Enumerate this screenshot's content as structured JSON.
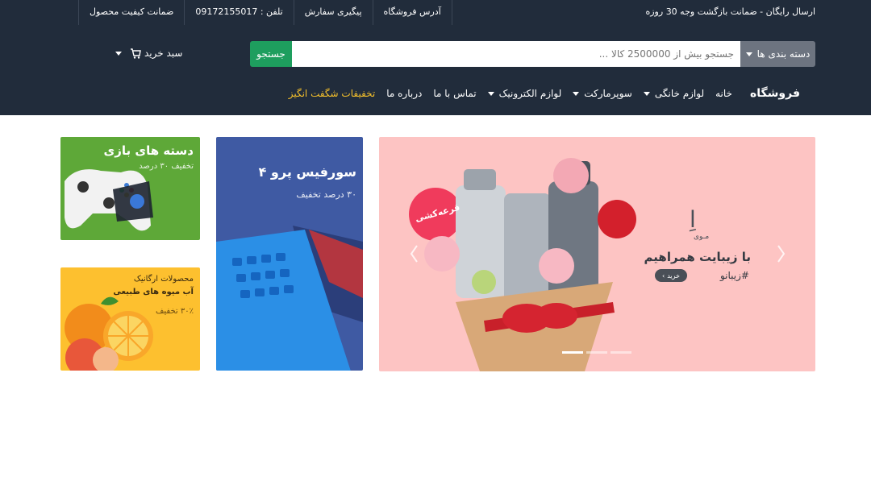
{
  "topbar": {
    "promo": "ارسال رایگان - ضمانت بازگشت وجه 30 روزه",
    "links": [
      "آدرس فروشگاه",
      "پیگیری سفارش",
      "تلفن : 09172155017",
      "ضمانت کیفیت محصول"
    ]
  },
  "search": {
    "category_label": "دسته بندی ها",
    "placeholder": "جستجو بیش از 2500000 کالا ...",
    "button_label": "جستجو"
  },
  "cart": {
    "label": "سبد خرید"
  },
  "nav": {
    "brand": "فروشگاه",
    "items": [
      {
        "label": "خانه",
        "dropdown": false
      },
      {
        "label": "لوازم خانگی",
        "dropdown": true
      },
      {
        "label": "سوپرمارکت",
        "dropdown": true
      },
      {
        "label": "لوازم الکترونیک",
        "dropdown": true
      },
      {
        "label": "تماس با ما",
        "dropdown": false
      },
      {
        "label": "درباره ما",
        "dropdown": false
      }
    ],
    "hot_item": "تخفیفات شگفت انگیز"
  },
  "banner": {
    "logo": "اِ",
    "logo_sub": "مـوی",
    "headline": "با زیبایت همراهیم",
    "hashtag": "#زیبانو",
    "buy_label": "خرید",
    "raffle": "قرعه‌کشی",
    "slides_count": 3,
    "active_slide": 1
  },
  "tiles": {
    "surface": {
      "title": "سورفیس پرو ۴",
      "subtitle": "۳۰ درصد تخفیف"
    },
    "game": {
      "title": "دسته های بازی",
      "subtitle": "تخفیف ۳۰ درصد"
    },
    "fruit": {
      "title": "محصولات ارگانیک",
      "subtitle": "آب میوه های طبیعی",
      "discount": "۳۰٪ تخفیف"
    }
  },
  "colors": {
    "header_bg": "#212c3b",
    "search_button": "#1e9e5e",
    "hot_link": "#f5c02b",
    "banner_bg": "#fdc4c3"
  }
}
